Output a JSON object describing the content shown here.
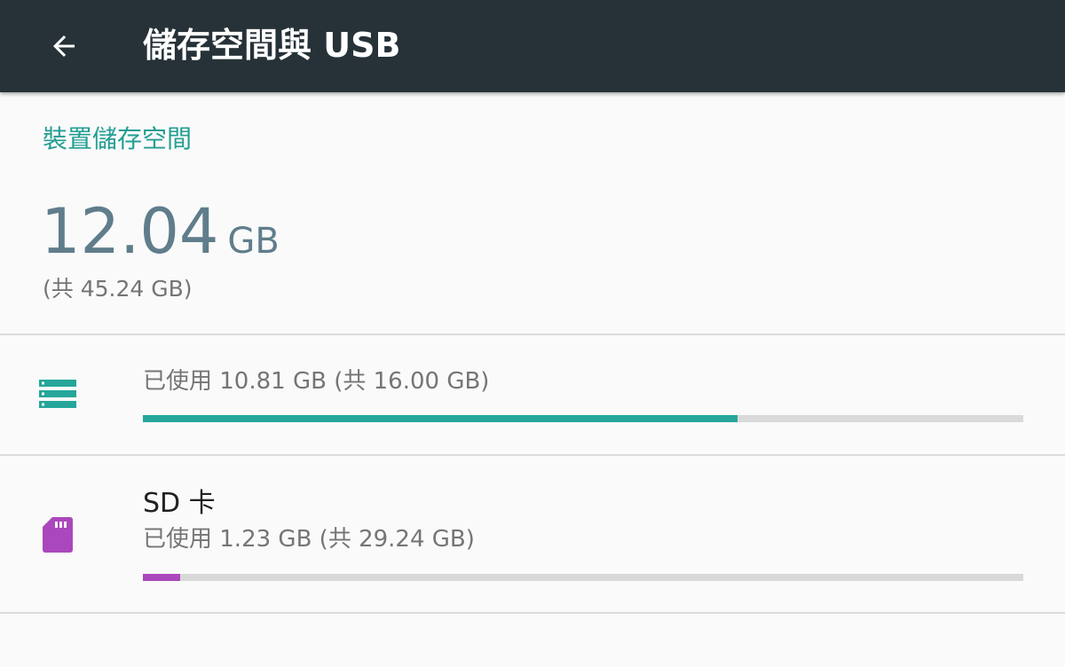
{
  "app_bar": {
    "back_icon": "arrow-back-icon",
    "title": "儲存空間與 USB"
  },
  "section": {
    "header": "裝置儲存空間"
  },
  "summary": {
    "used_value": "12.04",
    "used_unit": "GB",
    "total_text": "(共 45.24 GB)"
  },
  "volumes": [
    {
      "icon": "internal-storage-icon",
      "title": "",
      "summary": "已使用 10.81 GB (共 16.00 GB)",
      "used_fraction": 0.6757,
      "color": "#26a69a"
    },
    {
      "icon": "sd-card-icon",
      "title": "SD 卡",
      "summary": "已使用 1.23 GB (共 29.24 GB)",
      "used_fraction": 0.042,
      "color": "#ab47bc"
    }
  ],
  "colors": {
    "app_bar": "#263238",
    "accent": "#239e92",
    "summary_value": "#607d8b",
    "bar_track": "#d9d9d9"
  }
}
